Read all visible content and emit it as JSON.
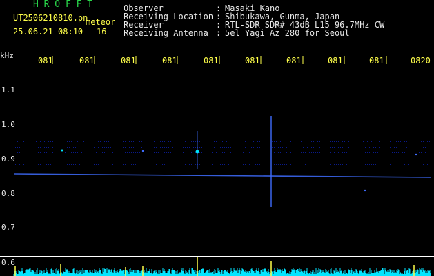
{
  "header": {
    "brand": "H R O F F T",
    "filename": "UT2506210810.pn",
    "meteor_label": "meteor",
    "datetime": "25.06.21 08:10",
    "count": "16",
    "fields": [
      {
        "label": "Observer",
        "sep": ":",
        "value": "Masaki Kano"
      },
      {
        "label": "Receiving Location",
        "sep": ":",
        "value": "Shibukawa, Gunma, Japan"
      },
      {
        "label": "Receiver",
        "sep": ":",
        "value": "RTL-SDR SDR# 43dB L15 96.7MHz CW"
      },
      {
        "label": "Receiving Antenna",
        "sep": ":",
        "value": "5el Yagi Az 280 for Seoul"
      }
    ]
  },
  "axes": {
    "y_unit": "kHz",
    "y_ticks": [
      "1.1",
      "1.0",
      "0.9",
      "0.8",
      "0.7",
      "0.6"
    ],
    "x_ticks": [
      "081",
      "081",
      "081",
      "081",
      "081",
      "081",
      "081",
      "081",
      "081",
      "0820"
    ]
  },
  "colors": {
    "background": "#000000",
    "grid": "#0a1a8a",
    "signal": "#3f6dff",
    "trace": "#00e5ff",
    "tick": "#ffff4a",
    "header_green": "#29d84a",
    "header_yellow": "#ffff4a"
  }
}
